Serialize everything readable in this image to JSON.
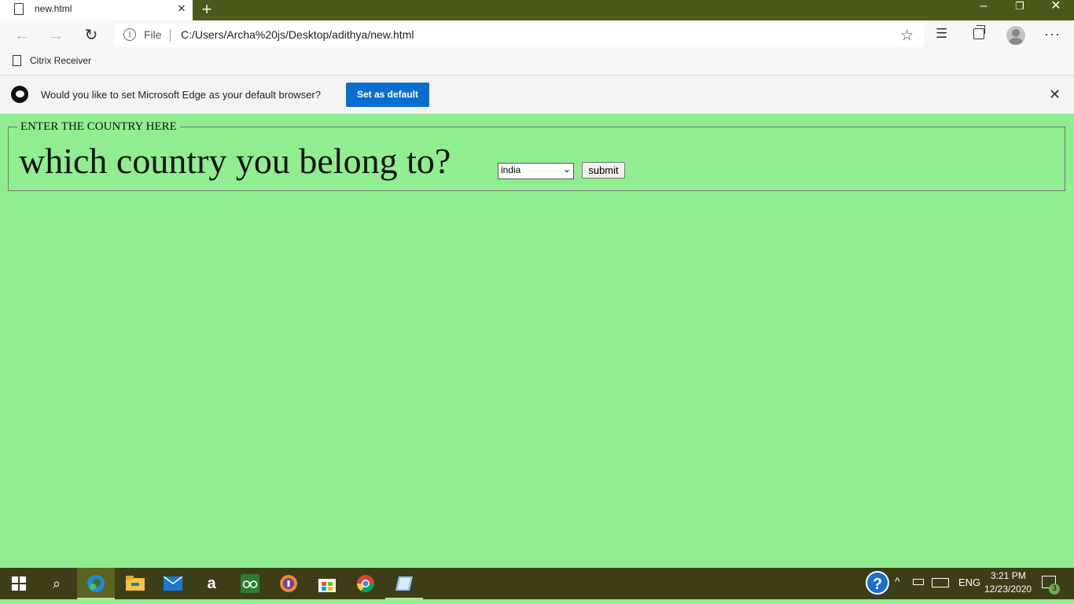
{
  "browser": {
    "tab_title": "new.html",
    "new_tab_symbol": "+",
    "window_controls": {
      "minimize": "–",
      "restore": "❐",
      "close": "✕"
    },
    "address": {
      "scheme_label": "File",
      "url": "C:/Users/Archa%20js/Desktop/adithya/new.html"
    },
    "favorites": [
      {
        "label": "Citrix Receiver"
      }
    ],
    "banner": {
      "text": "Would you like to set Microsoft Edge as your default browser?",
      "button_label": "Set as default"
    }
  },
  "page": {
    "background": "#90ee90",
    "legend": "ENTER THE COUNTRY HERE",
    "question": "which country you belong to?",
    "select_value": "india",
    "submit_label": "submit"
  },
  "taskbar": {
    "apps": [
      "start-icon",
      "search-icon",
      "edge-icon",
      "file-explorer-icon",
      "mail-icon",
      "amazon-icon",
      "tripadvisor-icon",
      "vpn-icon",
      "store-icon",
      "chrome-icon",
      "notepad-icon"
    ],
    "tray": {
      "language": "ENG",
      "time": "3:21 PM",
      "date": "12/23/2020",
      "notifications": "3"
    }
  },
  "colors": {
    "titlebar": "#4a5a1a",
    "taskbar": "#3c3e17",
    "accent_button": "#0a6ed1"
  }
}
